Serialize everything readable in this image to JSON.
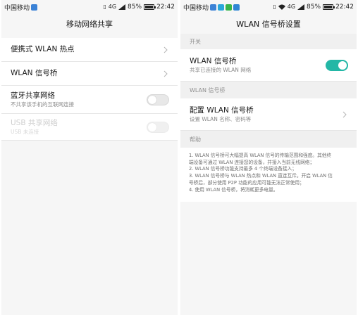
{
  "left": {
    "status": {
      "carrier": "中国移动",
      "network": "4G",
      "battery": "85%",
      "battery_level": 0.85,
      "time": "22:42"
    },
    "title": "移动网络共享",
    "items": [
      {
        "title": "便携式 WLAN 热点"
      },
      {
        "title": "WLAN 信号桥"
      },
      {
        "title": "蓝牙共享网络",
        "subtitle": "不共享该手机的互联网连接",
        "toggle": "off"
      },
      {
        "title": "USB 共享网络",
        "subtitle": "USB 未连接",
        "toggle": "off",
        "disabled": true
      }
    ]
  },
  "right": {
    "status": {
      "carrier": "中国移动",
      "network": "4G",
      "battery": "85%",
      "battery_level": 0.85,
      "time": "22:42"
    },
    "title": "WLAN 信号桥设置",
    "sections": {
      "switch": "开关",
      "wlan": "WLAN 信号桥",
      "help": "帮助"
    },
    "bridge": {
      "title": "WLAN 信号桥",
      "subtitle": "共享已连接的 WLAN 网络",
      "toggle": "on"
    },
    "config": {
      "title": "配置 WLAN 信号桥",
      "subtitle": "设置 WLAN 名称、密码等"
    },
    "help_lines": [
      "1. WLAN 信号桥可大幅提高 WLAN 信号的传输范围和强度。其他终",
      "端设备可通过 WLAN 连接您的设备，并接入当前无线网络；",
      "2. WLAN 信号桥功能支持最多 4 个终端设备接入；",
      "3. WLAN 信号桥与 WLAN 热点和 WLAN 直连互斥。开启 WLAN 信",
      "号桥后，部分使用 P2P 功能的应用可能无法正常使用；",
      "4. 使用 WLAN 信号桥，将消耗更多电量。"
    ]
  },
  "colors": {
    "accent": "#23b7a6",
    "background": "#f6f6f6",
    "section": "#f0f0f0"
  },
  "icons": [
    "vibrate-icon",
    "signal-icon",
    "wifi-icon",
    "chevron-right-icon",
    "notification-app-icon"
  ]
}
